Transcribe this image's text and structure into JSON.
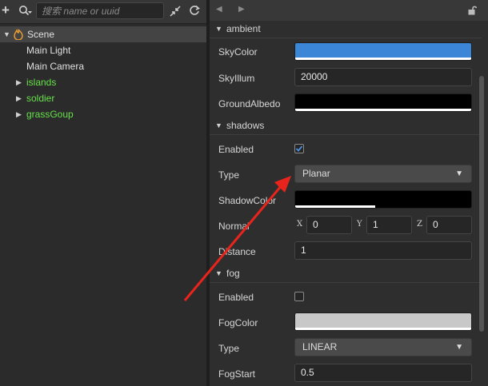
{
  "hierarchy": {
    "toolbar": {
      "add_icon": "plus-icon",
      "search_type_icon": "search-icon",
      "search_placeholder": "搜索 name or uuid",
      "collapse_icon": "collapse-icon",
      "refresh_icon": "refresh-icon"
    },
    "tree": {
      "scene": "Scene",
      "items": [
        {
          "label": "Main Light",
          "expandable": false
        },
        {
          "label": "Main Camera",
          "expandable": false
        },
        {
          "label": "islands",
          "expandable": true
        },
        {
          "label": "soldier",
          "expandable": true
        },
        {
          "label": "grassGoup",
          "expandable": true
        }
      ]
    }
  },
  "inspector": {
    "nav": {
      "back": "◀",
      "forward": "▶"
    },
    "ambient": {
      "title": "ambient",
      "sky_color_label": "SkyColor",
      "sky_color": "#3b86d6",
      "sky_illum_label": "SkyIllum",
      "sky_illum_value": "20000",
      "ground_albedo_label": "GroundAlbedo",
      "ground_albedo_color": "#000000"
    },
    "shadows": {
      "title": "shadows",
      "enabled_label": "Enabled",
      "enabled": true,
      "type_label": "Type",
      "type_value": "Planar",
      "shadow_color_label": "ShadowColor",
      "shadow_color": "#000000",
      "normal_label": "Normal",
      "normal": {
        "x_label": "X",
        "x": "0",
        "y_label": "Y",
        "y": "1",
        "z_label": "Z",
        "z": "0"
      },
      "distance_label": "Distance",
      "distance_value": "1"
    },
    "fog": {
      "title": "fog",
      "enabled_label": "Enabled",
      "enabled": false,
      "fog_color_label": "FogColor",
      "fog_color": "#c8c8c8",
      "type_label": "Type",
      "type_value": "LINEAR",
      "fog_start_label": "FogStart",
      "fog_start_value": "0.5"
    }
  },
  "colors": {
    "accent_green": "#66e04a",
    "annotation_arrow": "#e8241c",
    "check_blue": "#4a90e2"
  }
}
